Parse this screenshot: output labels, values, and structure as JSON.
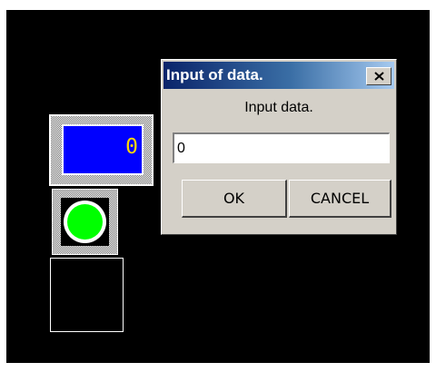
{
  "numeric_display": {
    "value": "0"
  },
  "lamp": {
    "state": "on",
    "color": "#00ff00"
  },
  "dialog": {
    "title": "Input of data.",
    "close_icon": "close-x-icon",
    "prompt": "Input data.",
    "input_value": "0",
    "ok_label": "OK",
    "cancel_label": "CANCEL"
  }
}
